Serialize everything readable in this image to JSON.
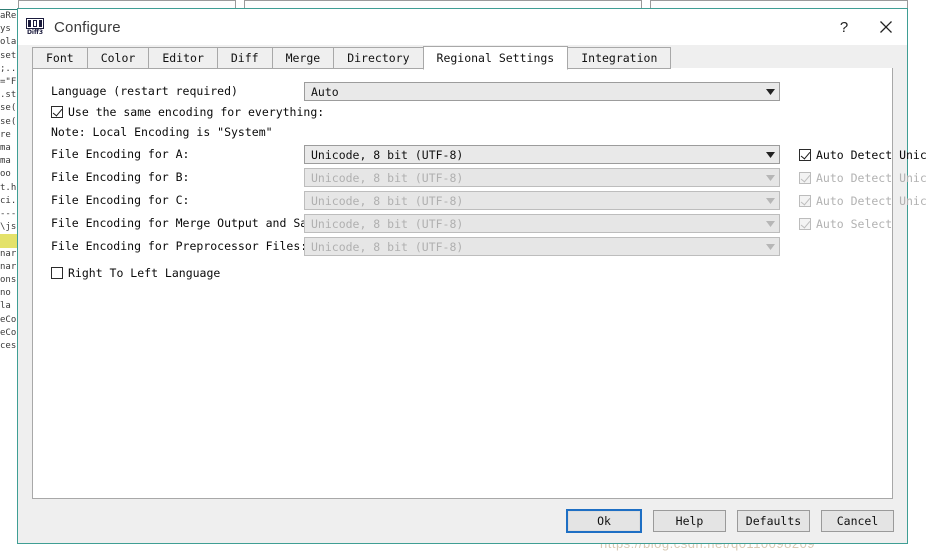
{
  "background": {
    "gutter_text": "aRe\nys\nola\nset\n;..\n=\"F\n.st\nse(\nse(\nre\n\n\nma\nma\noo\n\nt.h\nci.\n---\n\\js\n\nHIGHLIGHT\nnar\nnar\nons\n\nno\nla\neCo\neCo\nces",
    "pane1_text": "",
    "pane2_text": "",
    "pane3_text": "",
    "watermark": "https://blog.csdn.net/q0110098209"
  },
  "titlebar": {
    "icon": "diff3-app-icon",
    "icon_label": "Diff3",
    "title": "Configure",
    "help_label": "?",
    "close_label": "close-icon"
  },
  "tabs": [
    {
      "label": "Font",
      "selected": false
    },
    {
      "label": "Color",
      "selected": false
    },
    {
      "label": "Editor",
      "selected": false
    },
    {
      "label": "Diff",
      "selected": false
    },
    {
      "label": "Merge",
      "selected": false
    },
    {
      "label": "Directory",
      "selected": false
    },
    {
      "label": "Regional Settings",
      "selected": true
    },
    {
      "label": "Integration",
      "selected": false
    }
  ],
  "content": {
    "language_label": "Language (restart required)",
    "language_value": "Auto",
    "same_encoding_label": "Use the same encoding for everything:",
    "same_encoding_checked": true,
    "note_label": "Note: Local Encoding is \"System\"",
    "encoding_rows": [
      {
        "label": "File Encoding for A:",
        "value": "Unicode, 8 bit (UTF-8)",
        "disabled": false,
        "side_label": "Auto Detect Unicode",
        "side_checked": true,
        "side_disabled": false
      },
      {
        "label": "File Encoding for B:",
        "value": "Unicode, 8 bit (UTF-8)",
        "disabled": true,
        "side_label": "Auto Detect Unicode",
        "side_checked": true,
        "side_disabled": true
      },
      {
        "label": "File Encoding for C:",
        "value": "Unicode, 8 bit (UTF-8)",
        "disabled": true,
        "side_label": "Auto Detect Unicode",
        "side_checked": true,
        "side_disabled": true
      },
      {
        "label": "File Encoding for Merge Output and Saving:",
        "value": "Unicode, 8 bit (UTF-8)",
        "disabled": true,
        "side_label": "Auto Select",
        "side_checked": true,
        "side_disabled": true
      },
      {
        "label": "File Encoding for Preprocessor Files:",
        "value": "Unicode, 8 bit (UTF-8)",
        "disabled": true,
        "side_label": "",
        "side_checked": false,
        "side_disabled": true
      }
    ],
    "rtl_label": "Right To Left Language",
    "rtl_checked": false
  },
  "footer": {
    "ok_label": "Ok",
    "help_label": "Help",
    "defaults_label": "Defaults",
    "cancel_label": "Cancel"
  },
  "colors": {
    "dialog_border": "#3f9e94",
    "focus_blue": "#1e6fc4",
    "dialog_face": "#efefef",
    "content_bg": "#ffffff",
    "disabled_text": "#b0b0b0",
    "highlight_yellow": "#e4e26a"
  }
}
